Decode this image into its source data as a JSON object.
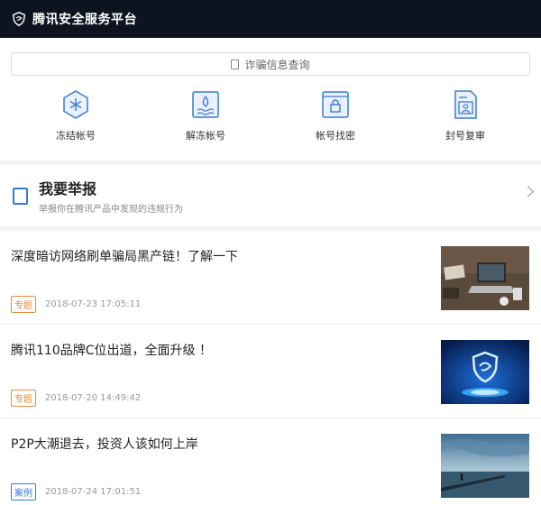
{
  "header": {
    "title": "腾讯安全服务平台"
  },
  "search": {
    "label": "诈骗信息查询"
  },
  "tools": [
    {
      "label": "冻结帐号",
      "icon": "snowflake-hex-icon"
    },
    {
      "label": "解冻帐号",
      "icon": "melting-drop-icon"
    },
    {
      "label": "帐号找密",
      "icon": "lock-browser-icon"
    },
    {
      "label": "封号复审",
      "icon": "profile-document-icon"
    }
  ],
  "report": {
    "title": "我要举报",
    "subtitle": "举报你在腾讯产品中发现的违规行为"
  },
  "articles": [
    {
      "title": "深度暗访网络刷单骗局黑产链！了解一下",
      "tag": "专题",
      "tag_color": "#e58b3a",
      "date": "2018-07-23 17:05:11",
      "thumb": "laptop-desk-photo"
    },
    {
      "title": "腾讯110品牌C位出道，全面升级 ！",
      "tag": "专题",
      "tag_color": "#e58b3a",
      "date": "2018-07-20 14:49:42",
      "thumb": "blue-shield-photo"
    },
    {
      "title": "P2P大潮退去，投资人该如何上岸",
      "tag": "案例",
      "tag_color": "#3a7bd5",
      "date": "2018-07-24 17:01:51",
      "thumb": "sunset-pier-photo"
    }
  ],
  "colors": {
    "header_bg": "#0e1320",
    "accent_blue": "#3a7bd5",
    "tag_orange": "#e58b3a"
  }
}
